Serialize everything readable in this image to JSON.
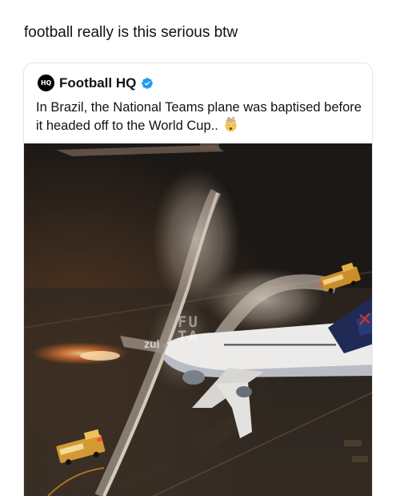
{
  "caption": "football really is this serious btw",
  "tweet": {
    "author": {
      "name": "Football HQ",
      "avatar_text": "HQ",
      "verified": true,
      "verified_icon": "verified-badge-icon",
      "verified_color": "#1d9bf0"
    },
    "text": "In Brazil, the National Teams plane was baptised before it headed off to the World Cup..",
    "emoji_icon": "mind-blown-emoji-icon",
    "media": {
      "watermark_line1": "FU",
      "watermark_line2": "TA",
      "airline_mark": "zul"
    }
  }
}
